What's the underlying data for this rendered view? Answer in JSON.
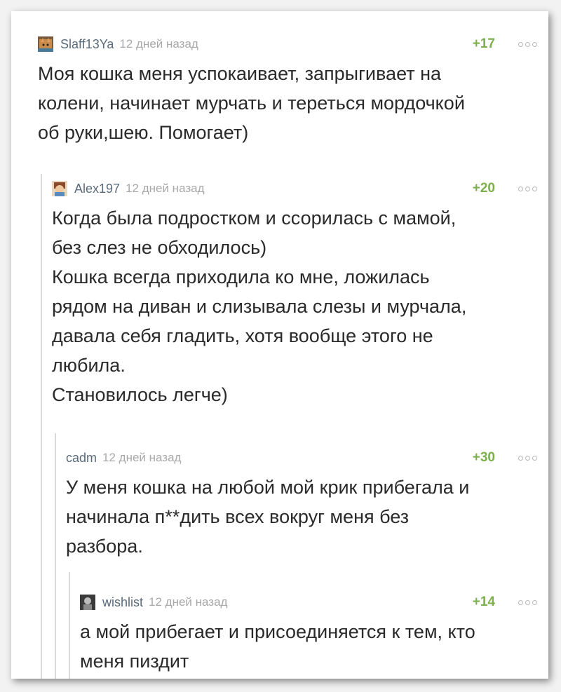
{
  "comments": [
    {
      "author": "Slaff13Ya",
      "time": "12 дней назад",
      "rating": "+17",
      "text": "Моя кошка меня успокаивает, запрыгивает на\nколени, начинает мурчать и тереться мордочкой\nоб руки,шею. Помогает)",
      "avatar_icon": "cat-avatar-icon"
    },
    {
      "author": "Alex197",
      "time": "12 дней назад",
      "rating": "+20",
      "text": "Когда была подростком и ссорилась с мамой,\nбез слез не обходилось)\nКошка всегда приходила ко мне, ложилась\nрядом на диван и слизывала слезы и мурчала,\nдавала себя гладить, хотя вообще этого не\nлюбила.\nСтановилось легче)",
      "avatar_icon": "cartoon-avatar-icon"
    },
    {
      "author": "cadm",
      "time": "12 дней назад",
      "rating": "+30",
      "text": "У меня кошка на любой мой крик прибегала и\nначинала п**дить всех вокруг меня без\nразбора.",
      "avatar_icon": ""
    },
    {
      "author": "wishlist",
      "time": "12 дней назад",
      "rating": "+14",
      "text": "а мой прибегает и присоединяется к тем, кто\nменя пиздит",
      "avatar_icon": "photo-avatar-icon"
    }
  ],
  "colors": {
    "rating": "#7bb04b",
    "author": "#5a6b7c",
    "time": "#a8a8a8",
    "text": "#2a2a2a",
    "thread_line": "#dadada"
  }
}
